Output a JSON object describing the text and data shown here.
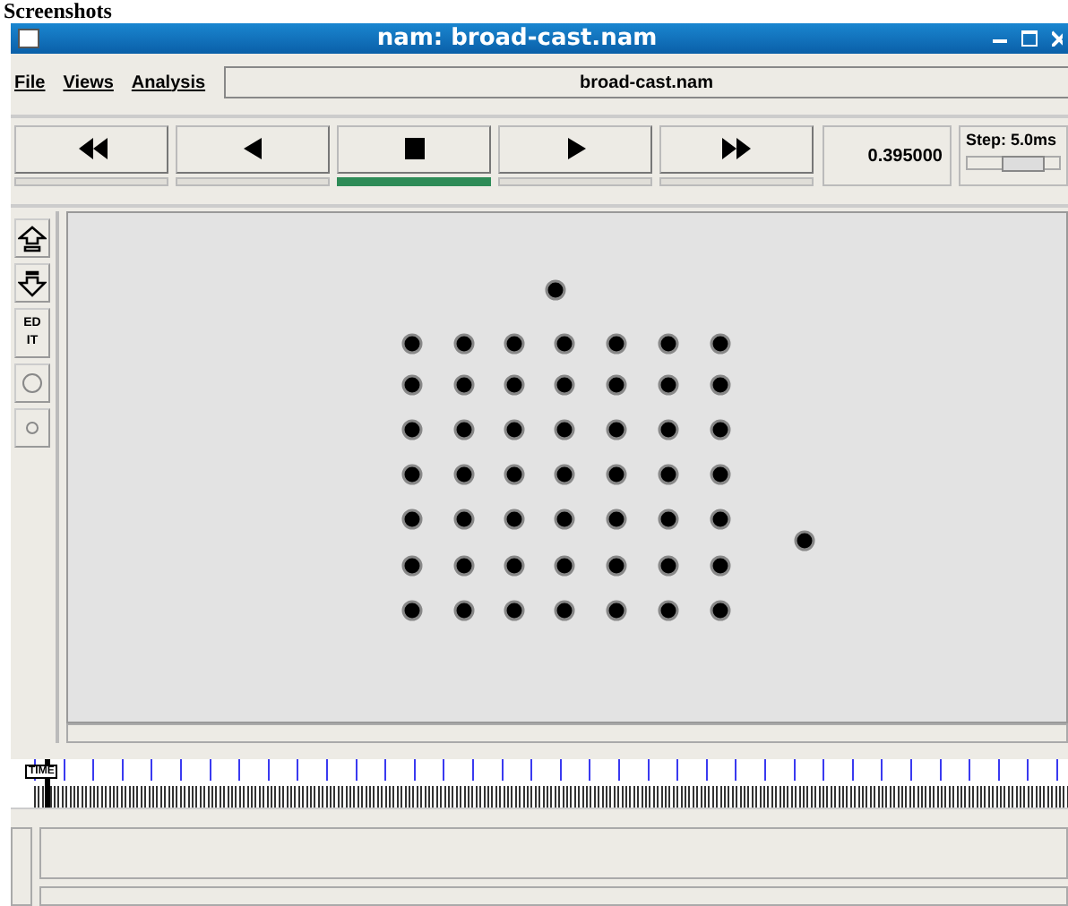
{
  "heading": "Screenshots",
  "window": {
    "title": "nam: broad-cast.nam"
  },
  "menu": [
    "File",
    "Views",
    "Analysis"
  ],
  "file_name": "broad-cast.nam",
  "controls": [
    {
      "kind": "rewind",
      "selected": false
    },
    {
      "kind": "back",
      "selected": false
    },
    {
      "kind": "stop",
      "selected": true
    },
    {
      "kind": "play",
      "selected": false
    },
    {
      "kind": "forward",
      "selected": false
    }
  ],
  "time": "0.395000",
  "step": {
    "label": "Step: 5.0ms",
    "level": 0.7
  },
  "tools": [
    {
      "kind": "zoom-in"
    },
    {
      "kind": "zoom-out"
    },
    {
      "kind": "edit",
      "label": "ED IT"
    },
    {
      "kind": "large-circle"
    },
    {
      "kind": "small-circle"
    }
  ],
  "timeline": {
    "label": "TIME",
    "level": 0.01
  }
}
